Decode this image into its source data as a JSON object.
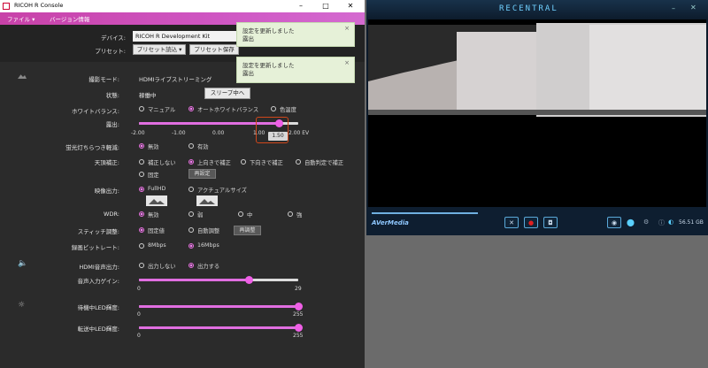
{
  "ricoh": {
    "title": "RICOH R Console",
    "menu": {
      "file": "ファイル",
      "version": "バージョン情報"
    },
    "device": {
      "label": "デバイス:",
      "value": "RICOH R Development Kit"
    },
    "preset": {
      "label": "プリセット:",
      "load": "プリセット読込",
      "save": "プリセット保存"
    },
    "mode": {
      "label": "撮影モード:",
      "value": "HDMIライブストリーミング"
    },
    "status": {
      "label": "状態:",
      "value": "稼働中",
      "button": "スリープ中へ"
    },
    "white_balance": {
      "label": "ホワイトバランス:",
      "options": [
        "マニュアル",
        "オートホワイトバランス",
        "色温度"
      ],
      "selected": 1
    },
    "exposure": {
      "label": "露出:",
      "value": 1.5,
      "value_label": "1.50",
      "min": -2,
      "max": 2,
      "ticks": [
        "-2.00",
        "-1.00",
        "0.00",
        "1.00",
        "2.00 EV"
      ]
    },
    "flicker": {
      "label": "蛍光灯ちらつき軽減:",
      "options": [
        "無効",
        "有効"
      ],
      "selected": 0
    },
    "zenith": {
      "label": "天頂補正:",
      "options": [
        "補正しない",
        "上向きで補正",
        "下向きで補正",
        "自動判定で補正",
        "固定"
      ],
      "selected": 1,
      "button": "再設定"
    },
    "video_output": {
      "label": "映像出力:",
      "options": [
        "FullHD",
        "アクチュアルサイズ"
      ],
      "selected": 0
    },
    "wdr": {
      "label": "WDR:",
      "options": [
        "無効",
        "弱",
        "中",
        "強"
      ],
      "selected": 0
    },
    "stitch": {
      "label": "スティッチ調整:",
      "options": [
        "固定値",
        "自動調整"
      ],
      "selected": 0,
      "button": "再調整"
    },
    "bitrate": {
      "label": "録画ビットレート:",
      "options": [
        "8Mbps",
        "16Mbps"
      ],
      "selected": 1
    },
    "hdmi_audio": {
      "label": "HDMI音声出力:",
      "options": [
        "出力しない",
        "出力する"
      ],
      "selected": 1
    },
    "audio_gain": {
      "label": "音声入力ゲイン:",
      "value": 20,
      "min": 0,
      "max": 29,
      "min_label": "0",
      "max_label": "29"
    },
    "standby_led": {
      "label": "待機中LED輝度:",
      "value": 255,
      "min": 0,
      "max": 255,
      "min_label": "0",
      "max_label": "255"
    },
    "transfer_led": {
      "label": "転送中LED輝度:",
      "value": 255,
      "min": 0,
      "max": 255,
      "min_label": "0",
      "max_label": "255"
    }
  },
  "toasts": [
    {
      "line1": "設定を更新しました",
      "line2": "露出"
    },
    {
      "line1": "設定を更新しました",
      "line2": "露出"
    }
  ],
  "recentral": {
    "logo": "RECENTRAL",
    "brand": "AVerMedia",
    "storage": "56.51 GB"
  },
  "icons": {
    "image": "image-icon",
    "speaker": "speaker-icon",
    "brightness": "brightness-icon"
  },
  "colors": {
    "accent": "#e06ee0",
    "menubar": "#cf56c3",
    "panel": "#2b2b2b",
    "rec_accent": "#6fd0ff"
  }
}
